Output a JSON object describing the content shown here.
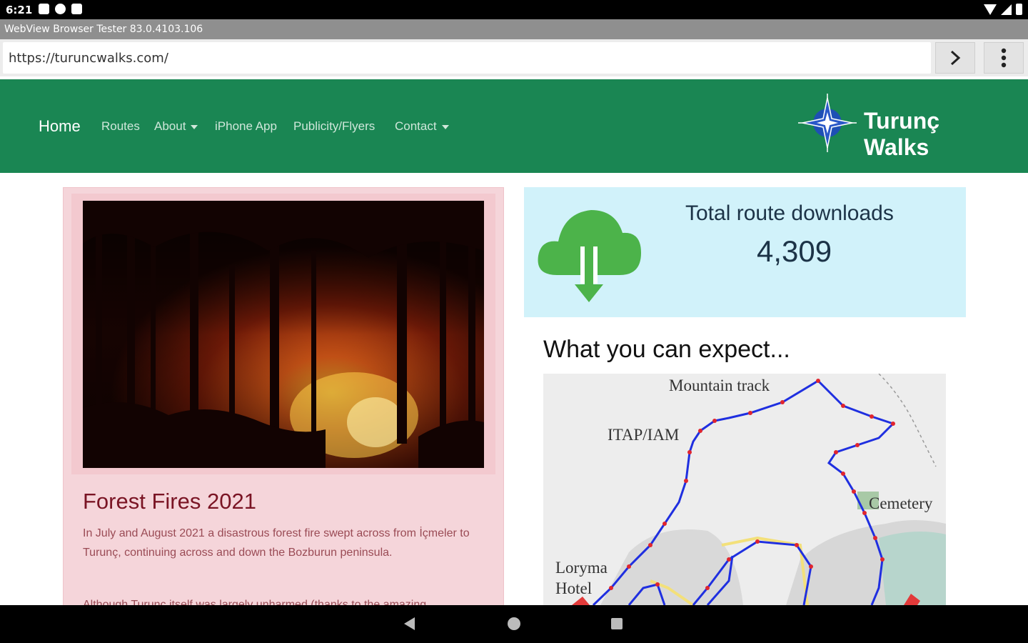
{
  "status_bar": {
    "time": "6:21"
  },
  "browser": {
    "title": "WebView Browser Tester 83.0.4103.106",
    "url": "https://turuncwalks.com/",
    "go_icon": "chevron-right-icon",
    "menu_icon": "more-vertical-icon"
  },
  "nav": {
    "home": "Home",
    "routes": "Routes",
    "about": "About",
    "iphone_app": "iPhone App",
    "publicity": "Publicity/Flyers",
    "contact": "Contact",
    "brand": "Turunç Walks",
    "brand_color": "#1a8653"
  },
  "news": {
    "title": "Forest Fires 2021",
    "p1": "In July and August 2021 a disastrous forest fire swept across from İçmeler to Turunç, continuing across and down the Bozburun peninsula.",
    "p2": "Although Turunç itself was largely unharmed (thanks to the amazing"
  },
  "downloads": {
    "label": "Total route downloads",
    "value": "4,309",
    "icon": "cloud-download-icon"
  },
  "expect": {
    "heading": "What you can expect...",
    "map_labels": {
      "mountain": "Mountain track",
      "itap": "ITAP/IAM",
      "cemetery": "Cemetery",
      "loryma1": "Loryma",
      "loryma2": "Hotel"
    }
  }
}
